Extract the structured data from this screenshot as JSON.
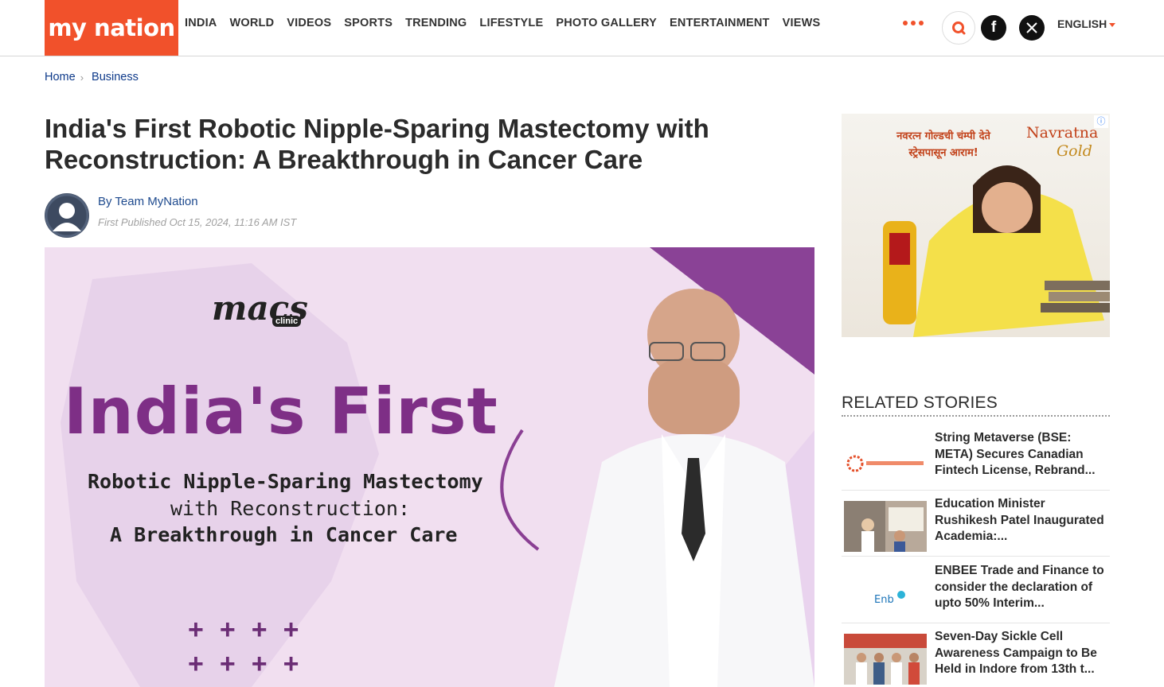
{
  "header": {
    "logo_text": "my nation",
    "nav": [
      "INDIA",
      "WORLD",
      "VIDEOS",
      "SPORTS",
      "TRENDING",
      "LIFESTYLE",
      "PHOTO GALLERY",
      "ENTERTAINMENT",
      "VIEWS"
    ],
    "language": "ENGLISH",
    "icons": {
      "more": "more-dots-icon",
      "search": "search-icon",
      "facebook": "facebook-icon",
      "x": "x-icon"
    },
    "accent_color": "#f1512b"
  },
  "breadcrumb": [
    "Home",
    "Business"
  ],
  "article": {
    "title": "India's First Robotic Nipple-Sparing Mastectomy with Reconstruction: A Breakthrough in Cancer Care",
    "author": "By Team MyNation",
    "published": "First Published Oct 15, 2024, 11:16 AM IST",
    "hero": {
      "brand": "macs",
      "brand_sub": "clinic",
      "big": "India's First",
      "line1": "Robotic Nipple-Sparing Mastectomy",
      "line2": "with Reconstruction:",
      "line3": "A Breakthrough in Cancer Care",
      "plus": "++++"
    }
  },
  "ad": {
    "text_line1": "नवरत्न गोल्डची चंम्पी देते",
    "text_line2": "स्ट्रेसपासून आराम!",
    "brand": "Navratna",
    "brand2": "Gold",
    "info": "ⓘ"
  },
  "related": {
    "title": "RELATED STORIES",
    "stories": [
      {
        "title": "String Metaverse (BSE: META) Secures Canadian Fintech License, Rebrand..."
      },
      {
        "title": "Education Minister Rushikesh Patel Inaugurated Academia:..."
      },
      {
        "title": "ENBEE Trade and Finance to consider the declaration of upto 50% Interim..."
      },
      {
        "title": "Seven-Day Sickle Cell Awareness Campaign to Be Held in Indore from 13th t..."
      }
    ]
  }
}
